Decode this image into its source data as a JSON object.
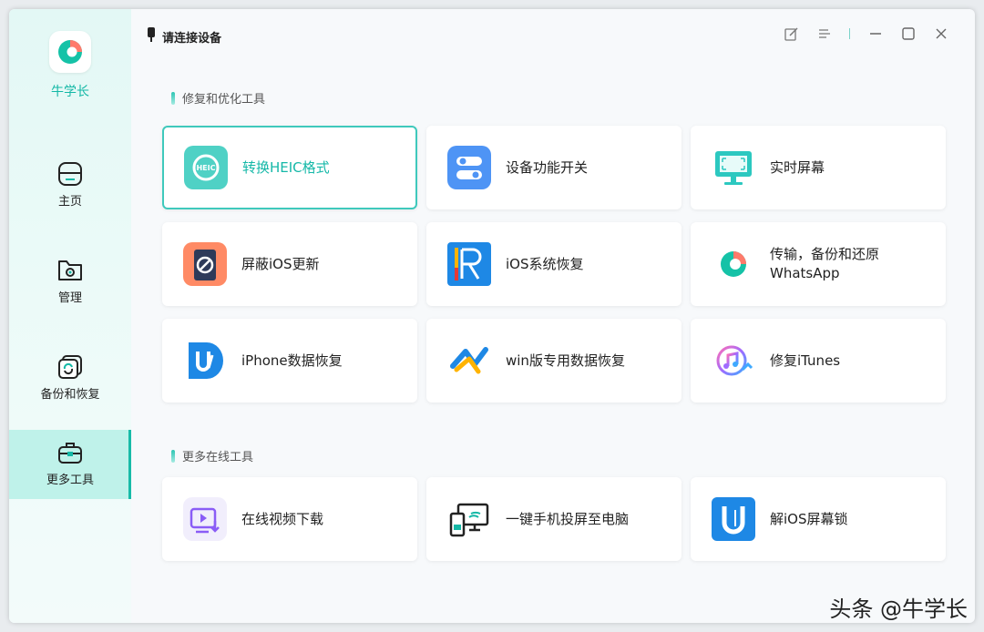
{
  "app": {
    "name": "牛学长"
  },
  "sidebar": {
    "items": [
      {
        "label": "主页",
        "icon": "home-icon"
      },
      {
        "label": "管理",
        "icon": "folder-gear-icon"
      },
      {
        "label": "备份和恢复",
        "icon": "backup-restore-icon"
      },
      {
        "label": "更多工具",
        "icon": "toolbox-icon"
      }
    ],
    "active_index": 3
  },
  "titlebar": {
    "device_status": "请连接设备",
    "buttons": [
      "feedback-icon",
      "menu-icon",
      "minimize-icon",
      "maximize-icon",
      "close-icon"
    ]
  },
  "sections": [
    {
      "title": "修复和优化工具",
      "tools": [
        {
          "label": "转换HEIC格式",
          "icon": "heic-convert-icon",
          "selected": true
        },
        {
          "label": "设备功能开关",
          "icon": "toggle-switches-icon"
        },
        {
          "label": "实时屏幕",
          "icon": "monitor-icon"
        },
        {
          "label": "屏蔽iOS更新",
          "icon": "block-update-icon"
        },
        {
          "label": "iOS系统恢复",
          "icon": "reiboot-icon"
        },
        {
          "label": "传输，备份和还原 WhatsApp",
          "icon": "whatsapp-transfer-icon"
        },
        {
          "label": "iPhone数据恢复",
          "icon": "ultdata-icon"
        },
        {
          "label": "win版专用数据恢复",
          "icon": "windows-recovery-icon"
        },
        {
          "label": "修复iTunes",
          "icon": "itunes-repair-icon"
        }
      ]
    },
    {
      "title": "更多在线工具",
      "tools": [
        {
          "label": "在线视频下载",
          "icon": "video-download-icon"
        },
        {
          "label": "一键手机投屏至电脑",
          "icon": "screen-mirror-icon"
        },
        {
          "label": "解iOS屏幕锁",
          "icon": "unlock-icon"
        }
      ]
    }
  ],
  "colors": {
    "accent": "#17bba8",
    "sidebar_active": "#bff2ea"
  },
  "watermark": "头条 @牛学长"
}
